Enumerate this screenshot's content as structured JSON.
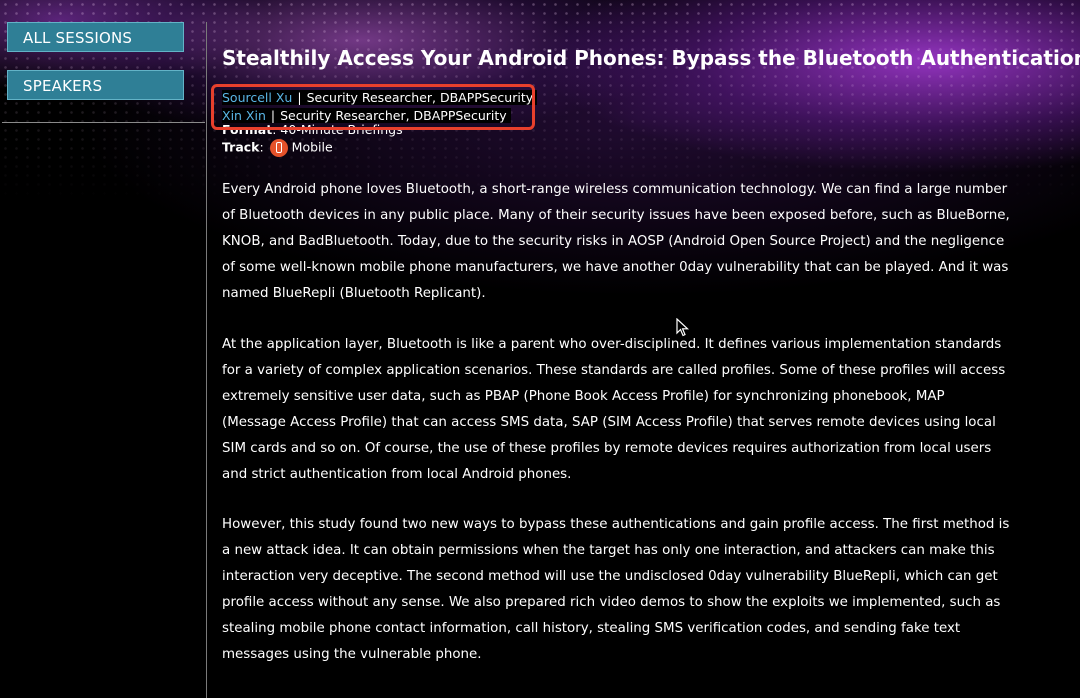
{
  "sidebar": {
    "items": [
      {
        "label": "ALL SESSIONS"
      },
      {
        "label": "SPEAKERS"
      }
    ]
  },
  "session": {
    "title": "Stealthily Access Your Android Phones: Bypass the Bluetooth Authentication",
    "speakers": [
      {
        "name": "Sourcell Xu",
        "separator": "|",
        "role": "Security Researcher, DBAPPSecurity"
      },
      {
        "name": "Xin Xin",
        "separator": "|",
        "role": "Security Researcher, DBAPPSecurity"
      }
    ],
    "format_label": "Format",
    "format_value": "40-Minute Briefings",
    "track_label": "Track",
    "track_value": "Mobile",
    "track_icon": "mobile-phone-icon",
    "paragraphs": [
      "Every Android phone loves Bluetooth, a short-range wireless communication technology. We can find a large number of Bluetooth devices in any public place. Many of their security issues have been exposed before, such as BlueBorne, KNOB, and BadBluetooth. Today, due to the security risks in AOSP (Android Open Source Project) and the negligence of some well-known mobile phone manufacturers, we have another 0day vulnerability that can be played. And it was named BlueRepli (Bluetooth Replicant).",
      "At the application layer, Bluetooth is like a parent who over-disciplined. It defines various implementation standards for a variety of complex application scenarios. These standards are called profiles. Some of these profiles will access extremely sensitive user data, such as PBAP (Phone Book Access Profile) for synchronizing phonebook, MAP (Message Access Profile) that can access SMS data, SAP (SIM Access Profile) that serves remote devices using local SIM cards and so on. Of course, the use of these profiles by remote devices requires authorization from local users and strict authentication from local Android phones.",
      "However, this study found two new ways to bypass these authentications and gain profile access. The first method is a new attack idea. It can obtain permissions when the target has only one interaction, and attackers can make this interaction very deceptive. The second method will use the undisclosed 0day vulnerability BlueRepli, which can get profile access without any sense. We also prepared rich video demos to show the exploits we implemented, such as stealing mobile phone contact information, call history, stealing SMS verification codes, and sending fake text messages using the vulnerable phone."
    ]
  },
  "colors": {
    "nav_button_bg": "#2f7f96",
    "speaker_link": "#5ab6e6",
    "highlight_box": "#e8402c",
    "track_icon_bg": "#e5522a"
  }
}
